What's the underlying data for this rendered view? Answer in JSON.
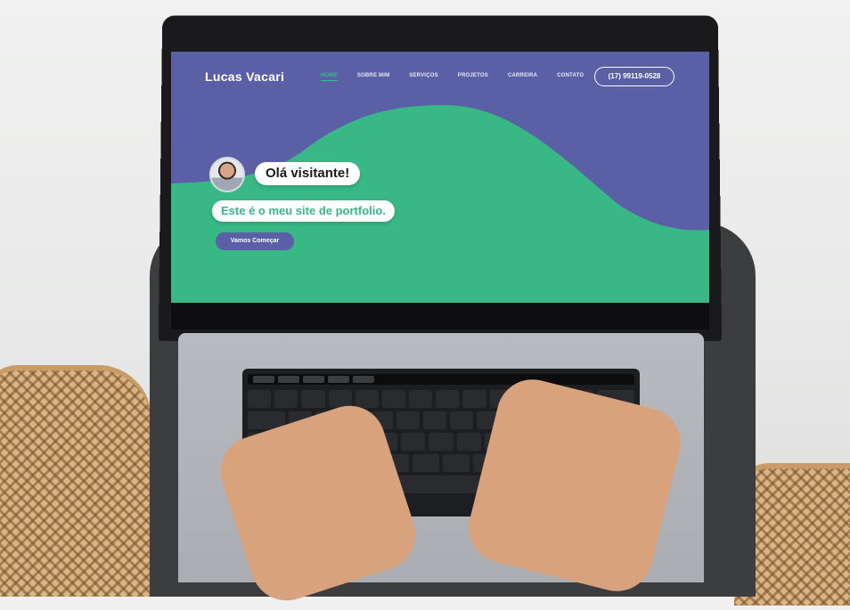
{
  "site": {
    "brand": "Lucas Vacari",
    "nav": [
      {
        "label": "HOME",
        "active": true
      },
      {
        "label": "SOBRE MIM",
        "active": false
      },
      {
        "label": "SERVIÇOS",
        "active": false
      },
      {
        "label": "PROJETOS",
        "active": false
      },
      {
        "label": "CARREIRA",
        "active": false
      },
      {
        "label": "CONTATO",
        "active": false
      }
    ],
    "phone": "(17) 99119-0528",
    "greeting": "Olá visitante!",
    "tagline": "Este é o meu site de portfolio.",
    "cta": "Vamos Começar"
  },
  "colors": {
    "header_bg": "#5a5fa6",
    "accent_green": "#38c08c",
    "text_white": "#ffffff"
  }
}
